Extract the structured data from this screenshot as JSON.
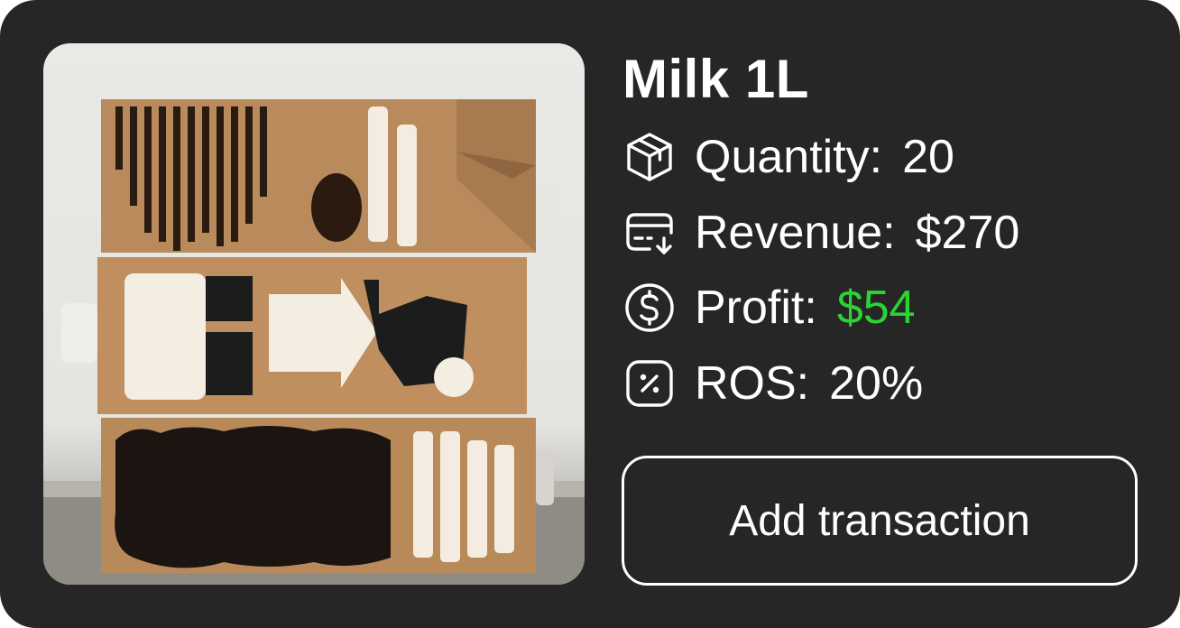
{
  "product": {
    "title": "Milk 1L",
    "image_alt": "Oat milk cartons"
  },
  "stats": {
    "quantity": {
      "label": "Quantity:",
      "value": "20",
      "icon": "box-icon"
    },
    "revenue": {
      "label": "Revenue:",
      "value": "$270",
      "icon": "card-receive-icon"
    },
    "profit": {
      "label": "Profit:",
      "value": "$54",
      "icon": "dollar-circle-icon",
      "value_color": "#2bd334"
    },
    "ros": {
      "label": "ROS:",
      "value": "20%",
      "icon": "percent-square-icon"
    }
  },
  "actions": {
    "add_transaction": "Add transaction"
  },
  "colors": {
    "card_background": "#262626",
    "text": "#ffffff",
    "profit_positive": "#2bd334"
  }
}
